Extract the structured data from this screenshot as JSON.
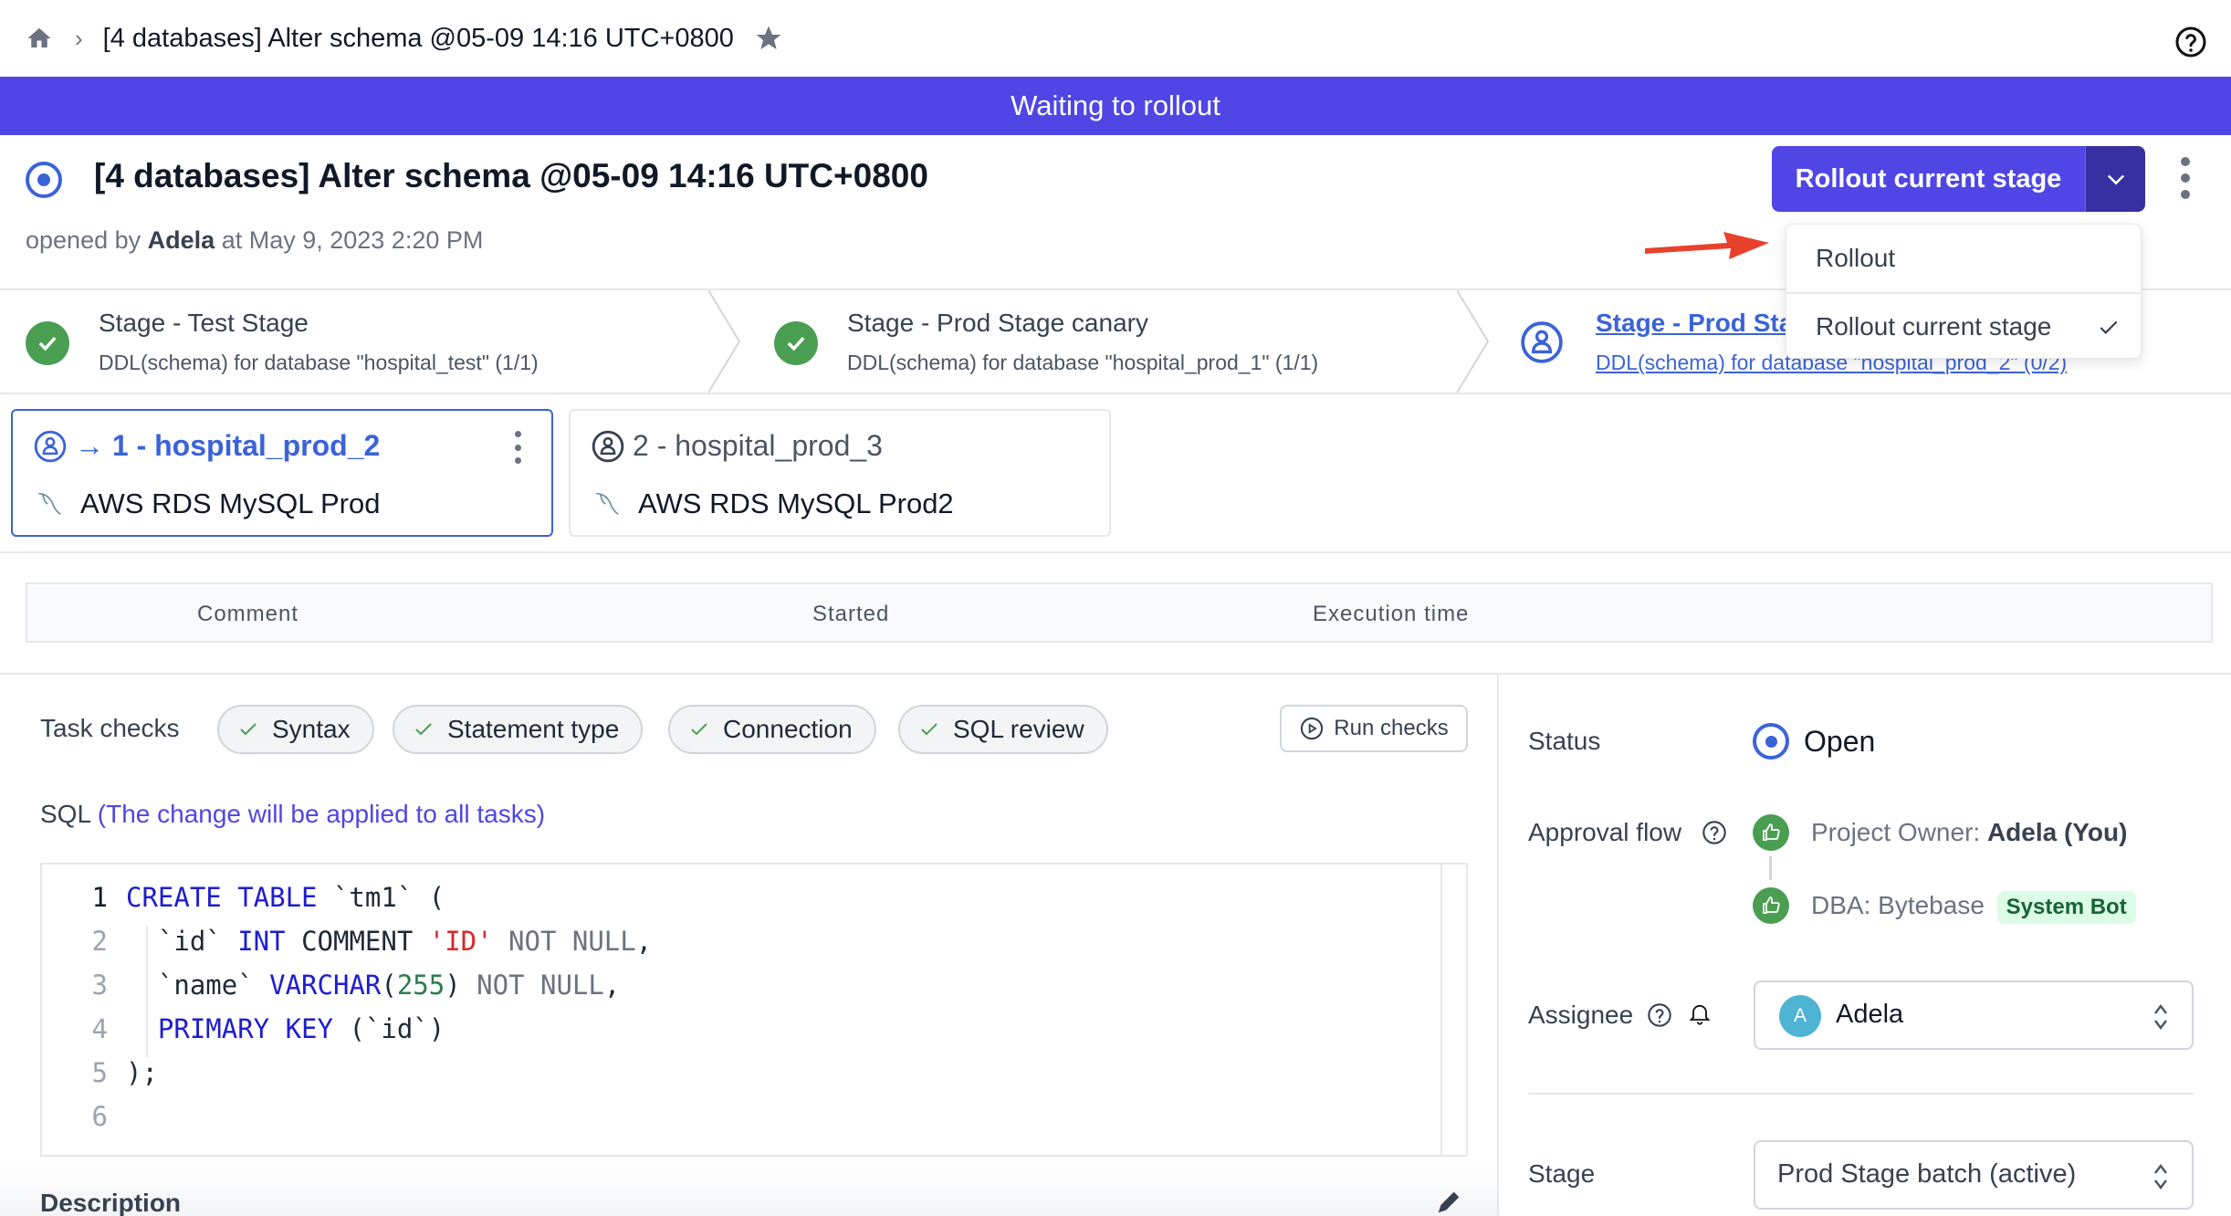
{
  "breadcrumb": {
    "home_icon": "home-icon",
    "separator_icon": "chevron-right-icon",
    "title": "[4 databases] Alter schema @05-09 14:16 UTC+0800",
    "star_icon": "star-icon",
    "help_icon": "help-circle-icon"
  },
  "banner": {
    "text": "Waiting to rollout",
    "color": "#4f46e5"
  },
  "issue": {
    "title": "[4 databases] Alter schema @05-09 14:16 UTC+0800",
    "opened_prefix": "opened by",
    "author": "Adela",
    "opened_at": "at May 9, 2023 2:20 PM"
  },
  "actions": {
    "primary_label": "Rollout current stage",
    "caret_icon": "chevron-down-icon",
    "more_icon": "kebab-icon",
    "dropdown": [
      {
        "label": "Rollout",
        "selected": false
      },
      {
        "label": "Rollout current stage",
        "selected": true
      }
    ]
  },
  "stages": [
    {
      "name": "Stage - Test Stage",
      "desc": "DDL(schema) for database \"hospital_test\" (1/1)",
      "status": "done"
    },
    {
      "name": "Stage - Prod Stage canary",
      "desc": "DDL(schema) for database \"hospital_prod_1\" (1/1)",
      "status": "done"
    },
    {
      "name": "Stage - Prod Stage batch",
      "desc": "DDL(schema) for database \"hospital_prod_2\"",
      "count": "(0/2)",
      "status": "active"
    }
  ],
  "tasks": [
    {
      "name": "→ 1 - hospital_prod_2",
      "instance": "AWS RDS MySQL Prod",
      "selected": true
    },
    {
      "name": "2 - hospital_prod_3",
      "instance": "AWS RDS MySQL Prod2",
      "selected": false
    }
  ],
  "task_table": {
    "columns": [
      "Comment",
      "Started",
      "Execution time"
    ]
  },
  "task_checks": {
    "label": "Task checks",
    "items": [
      "Syntax",
      "Statement type",
      "Connection",
      "SQL review"
    ],
    "run_label": "Run checks"
  },
  "sql": {
    "label": "SQL",
    "note": "(The change will be applied to all tasks)",
    "lines": [
      {
        "n": "1",
        "tokens": [
          [
            "kw",
            "CREATE TABLE"
          ],
          [
            "t",
            " `tm1` ("
          ]
        ]
      },
      {
        "n": "2",
        "tokens": [
          [
            "t",
            "  `id` "
          ],
          [
            "kw",
            "INT"
          ],
          [
            "t",
            " COMMENT "
          ],
          [
            "str",
            "'ID'"
          ],
          [
            "muted",
            " NOT NULL"
          ],
          [
            "t",
            ","
          ]
        ]
      },
      {
        "n": "3",
        "tokens": [
          [
            "t",
            "  `name` "
          ],
          [
            "kw",
            "VARCHAR"
          ],
          [
            "t",
            "("
          ],
          [
            "num",
            "255"
          ],
          [
            "t",
            ") "
          ],
          [
            "muted",
            "NOT NULL"
          ],
          [
            "t",
            ","
          ]
        ]
      },
      {
        "n": "4",
        "tokens": [
          [
            "t",
            "  "
          ],
          [
            "kw",
            "PRIMARY KEY"
          ],
          [
            "t",
            " (`id`)"
          ]
        ]
      },
      {
        "n": "5",
        "tokens": [
          [
            "t",
            ");"
          ]
        ]
      },
      {
        "n": "6",
        "tokens": []
      }
    ]
  },
  "description": {
    "label": "Description",
    "edit_icon": "pencil-icon"
  },
  "sidebar": {
    "status_label": "Status",
    "status_value": "Open",
    "approval_label": "Approval flow",
    "approvals": [
      {
        "role": "Project Owner:",
        "who": "Adela (You)",
        "badge": ""
      },
      {
        "role": "DBA:",
        "who": "Bytebase",
        "badge": "System Bot"
      }
    ],
    "assignee_label": "Assignee",
    "assignee_initial": "A",
    "assignee_name": "Adela",
    "stage_label": "Stage",
    "stage_value": "Prod Stage batch (active)"
  }
}
